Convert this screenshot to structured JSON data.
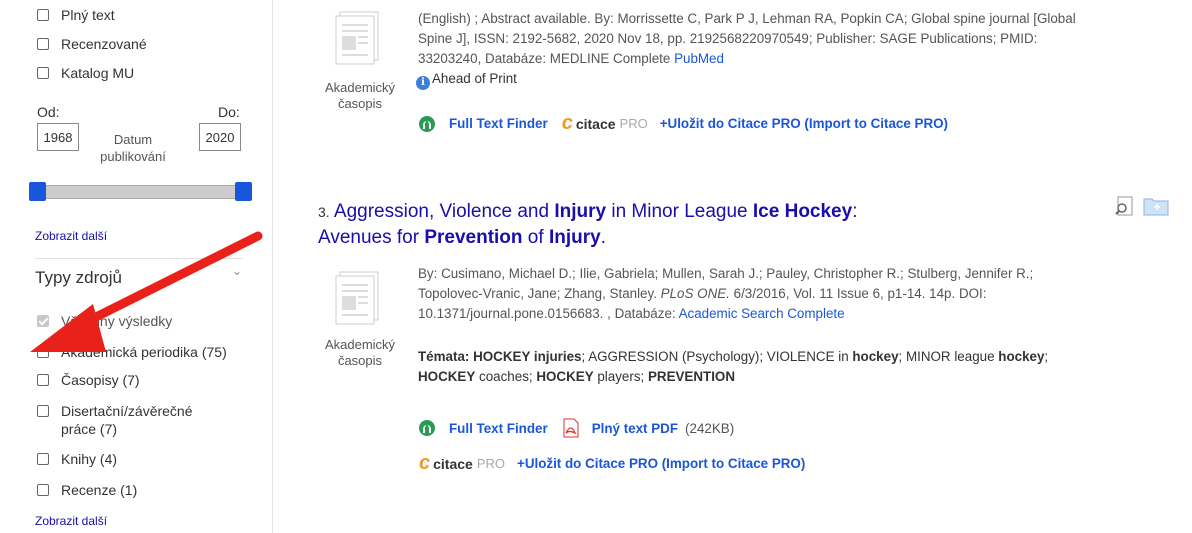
{
  "sidebar": {
    "top_cut_label": "Plný text",
    "filters_top": [
      {
        "label": "Recenzované"
      },
      {
        "label": "Katalog MU"
      }
    ],
    "date": {
      "from_label": "Od:",
      "to_label": "Do:",
      "from_value": "1968",
      "to_value": "2020",
      "caption_line1": "Datum",
      "caption_line2": "publikování"
    },
    "show_more_1": "Zobrazit další",
    "source_types_title": "Typy zdrojů",
    "source_types": [
      {
        "label": "Všechny výsledky",
        "checked": true
      },
      {
        "label": "Akademická periodika (75)",
        "checked": false
      },
      {
        "label": "Časopisy (7)",
        "checked": false
      },
      {
        "label": "Disertační/závěrečné",
        "label2": "práce (7)",
        "checked": false
      },
      {
        "label": "Knihy (4)",
        "checked": false
      },
      {
        "label": "Recenze (1)",
        "checked": false
      }
    ],
    "show_more_2": "Zobrazit další"
  },
  "results": {
    "result2": {
      "type_line1": "Akademický",
      "type_line2": "časopis",
      "line0": "(English) ; Abstract available. By: Morrissette C, Park P J, Lehman RA, Popkin CA; Global spine journal [Global",
      "line1": "Spine J], ISSN: 2192-5682, 2020 Nov 18, pp. 2192568220970549; Publisher: SAGE Publications; PMID:",
      "line2_prefix": "33203240, Databáze: MEDLINE Complete",
      "line2_link": "PubMed",
      "ahead": "Ahead of Print",
      "full_text_finder": "Full Text Finder",
      "citace": "citace",
      "pro": "PRO",
      "save_citace": "+Uložit do Citace PRO (Import to Citace PRO)"
    },
    "result3": {
      "number": "3.",
      "title_parts": [
        "Aggression, Violence and ",
        "Injury",
        " in Minor League ",
        "Ice Hockey",
        ":"
      ],
      "title_line2_parts": [
        "Avenues for ",
        "Prevention",
        " of ",
        "Injury",
        "."
      ],
      "type_line1": "Akademický",
      "type_line2": "časopis",
      "line1": "By: Cusimano, Michael D.; Ilie, Gabriela; Mullen, Sarah J.; Pauley, Christopher R.; Stulberg, Jennifer R.;",
      "line2_a": "Topolovec-Vranic, Jane; Zhang, Stanley.",
      "line2_journal": "PLoS ONE.",
      "line2_b": "6/3/2016, Vol. 11 Issue 6, p1-14. 14p. DOI:",
      "line3_prefix": "10.1371/journal.pone.0156683. , Databáze:",
      "line3_link": "Academic Search Complete",
      "subjects_label": "Témata:",
      "subj_1": "HOCKEY injuries",
      "subj_2": "; AGGRESSION (Psychology); VIOLENCE in ",
      "subj_3": "hockey",
      "subj_4": "; MINOR league ",
      "subj_5": "hockey",
      "subj_6": ";",
      "subj_7": "HOCKEY",
      "subj_8": " coaches; ",
      "subj_9": "HOCKEY",
      "subj_10": " players; ",
      "subj_11": "PREVENTION",
      "full_text_finder": "Full Text Finder",
      "pdf_label": "Plný text PDF",
      "pdf_size": "(242KB)",
      "citace": "citace",
      "pro": "PRO",
      "save_citace": "+Uložit do Citace PRO (Import to Citace PRO)"
    }
  },
  "colors": {
    "link_blue": "#1a56db",
    "title_blue": "#1a0dab",
    "annotation_arrow": "#e8221b",
    "slider_handle": "#1a56db"
  }
}
